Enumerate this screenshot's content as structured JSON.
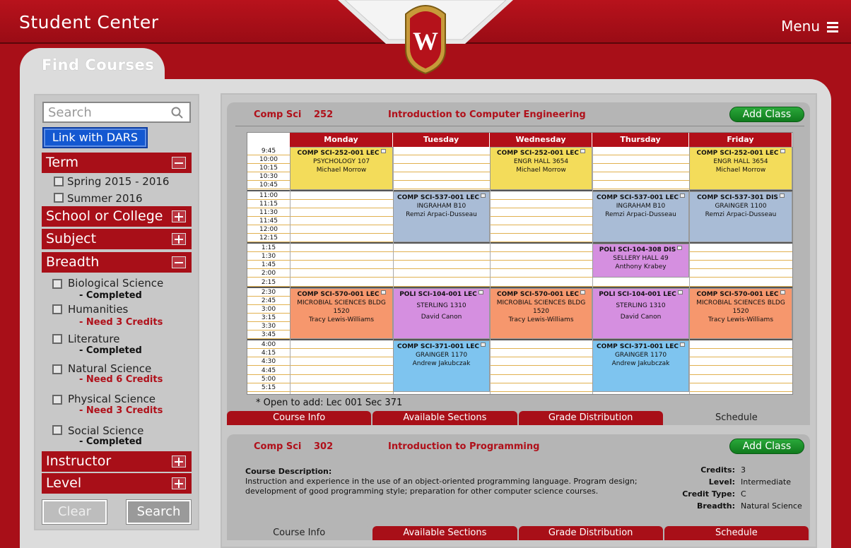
{
  "app_title": "Student Center",
  "menu_label": "Menu",
  "tab_label": "Find Courses",
  "sidebar": {
    "search_placeholder": "Search",
    "dars_label": "Link with DARS",
    "term": {
      "label": "Term",
      "options": [
        "Spring 2015 - 2016",
        "Summer 2016"
      ]
    },
    "school_label": "School or College",
    "subject_label": "Subject",
    "breadth": {
      "label": "Breadth",
      "items": [
        {
          "name": "Biological Science",
          "status": "- Completed"
        },
        {
          "name": "Humanities",
          "status": "- Need 3 Credits"
        },
        {
          "name": "Literature",
          "status": "- Completed"
        },
        {
          "name": "Natural Science",
          "status": "- Need 6 Credits"
        },
        {
          "name": "Physical Science",
          "status": "- Need 3 Credits"
        },
        {
          "name": "Social Science",
          "status": "- Completed"
        }
      ]
    },
    "instructor_label": "Instructor",
    "level_label": "Level",
    "clear_label": "Clear",
    "search_label": "Search"
  },
  "courses": [
    {
      "code": "Comp Sci",
      "number": "252",
      "title": "Introduction to Computer Engineering",
      "add_label": "Add Class",
      "open_note": "* Open to add: Lec 001 Sec 371",
      "tabs": [
        "Course Info",
        "Available Sections",
        "Grade Distribution",
        "Schedule"
      ],
      "active_tab": "Schedule"
    },
    {
      "code": "Comp Sci",
      "number": "302",
      "title": "Introduction to Programming",
      "add_label": "Add Class",
      "desc_label": "Course Description:",
      "desc_line1": "Instruction and experience in the use of an object-oriented programming language. Program design;",
      "desc_line2": "development of good programming style; preparation for other computer science courses.",
      "credits_key": "Credits:",
      "credits": "3",
      "level_key": "Level:",
      "level": "Intermediate",
      "credit_type_key": "Credit Type:",
      "credit_type": "C",
      "breadth_key": "Breadth:",
      "breadth": "Natural Science",
      "tabs": [
        "Course Info",
        "Available Sections",
        "Grade Distribution",
        "Schedule"
      ],
      "active_tab": "Course Info"
    }
  ],
  "schedule": {
    "days": [
      "Monday",
      "Tuesday",
      "Wednesday",
      "Thursday",
      "Friday"
    ],
    "times": [
      "9:45",
      "10:00",
      "10:15",
      "10:30",
      "10:45",
      "11:00",
      "11:15",
      "11:30",
      "11:45",
      "12:00",
      "12:15",
      "1:15",
      "1:30",
      "1:45",
      "2:00",
      "2:15",
      "2:30",
      "2:45",
      "3:00",
      "3:15",
      "3:30",
      "3:45",
      "4:00",
      "4:15",
      "4:30",
      "4:45",
      "5:00",
      "5:15"
    ],
    "blocks": [
      {
        "day": 0,
        "start": 0,
        "len": 5,
        "color": "#f3dc5a",
        "lines": [
          "COMP SCI-252-001 LEC",
          "PSYCHOLOGY 107",
          "Michael Morrow"
        ]
      },
      {
        "day": 2,
        "start": 0,
        "len": 5,
        "color": "#f3dc5a",
        "lines": [
          "COMP SCI-252-001 LEC",
          "ENGR HALL 3654",
          "Michael Morrow"
        ]
      },
      {
        "day": 4,
        "start": 0,
        "len": 5,
        "color": "#f3dc5a",
        "lines": [
          "COMP SCI-252-001 LEC",
          "ENGR HALL 3654",
          "Michael Morrow"
        ]
      },
      {
        "day": 1,
        "start": 5,
        "len": 6,
        "color": "#a9bcd6",
        "lines": [
          "COMP SCI-537-001 LEC",
          "INGRAHAM B10",
          "Remzi Arpaci-Dusseau"
        ]
      },
      {
        "day": 3,
        "start": 5,
        "len": 6,
        "color": "#a9bcd6",
        "lines": [
          "COMP SCI-537-001 LEC",
          "INGRAHAM B10",
          "Remzi Arpaci-Dusseau"
        ]
      },
      {
        "day": 4,
        "start": 5,
        "len": 6,
        "color": "#a9bcd6",
        "lines": [
          "COMP SCI-537-301 DIS",
          "GRAINGER 1100",
          "Remzi Arpaci-Dusseau"
        ]
      },
      {
        "day": 3,
        "start": 11,
        "len": 4,
        "color": "#d58fe0",
        "lines": [
          "POLI SCI-104-308 DIS",
          "SELLERY HALL 49",
          "Anthony Krabey"
        ]
      },
      {
        "day": 0,
        "start": 16,
        "len": 6,
        "color": "#f6976d",
        "lines": [
          "COMP SCI-570-001 LEC",
          "MICROBIAL SCIENCES BLDG",
          "1520",
          "Tracy Lewis-Williams"
        ]
      },
      {
        "day": 1,
        "start": 16,
        "len": 6,
        "color": "#d58fe0",
        "lines": [
          "POLI SCI-104-001 LEC",
          "",
          "STERLING 1310",
          "",
          "David Canon"
        ]
      },
      {
        "day": 2,
        "start": 16,
        "len": 6,
        "color": "#f6976d",
        "lines": [
          "COMP SCI-570-001 LEC",
          "MICROBIAL SCIENCES BLDG",
          "1520",
          "Tracy Lewis-Williams"
        ]
      },
      {
        "day": 3,
        "start": 16,
        "len": 6,
        "color": "#d58fe0",
        "lines": [
          "POLI SCI-104-001 LEC",
          "",
          "STERLING 1310",
          "",
          "David Canon"
        ]
      },
      {
        "day": 4,
        "start": 16,
        "len": 6,
        "color": "#f6976d",
        "lines": [
          "COMP SCI-570-001 LEC",
          "MICROBIAL SCIENCES BLDG",
          "1520",
          "Tracy Lewis-Williams"
        ]
      },
      {
        "day": 1,
        "start": 22,
        "len": 6,
        "color": "#7ec4ef",
        "lines": [
          "COMP SCI-371-001 LEC",
          "GRAINGER 1170",
          "Andrew Jakubczak"
        ]
      },
      {
        "day": 3,
        "start": 22,
        "len": 6,
        "color": "#7ec4ef",
        "lines": [
          "COMP SCI-371-001 LEC",
          "GRAINGER 1170",
          "Andrew Jakubczak"
        ]
      }
    ]
  },
  "colors": {
    "brand_red": "#a80f18",
    "add_green": "#1f9a2e",
    "dars_blue": "#1358d1"
  }
}
